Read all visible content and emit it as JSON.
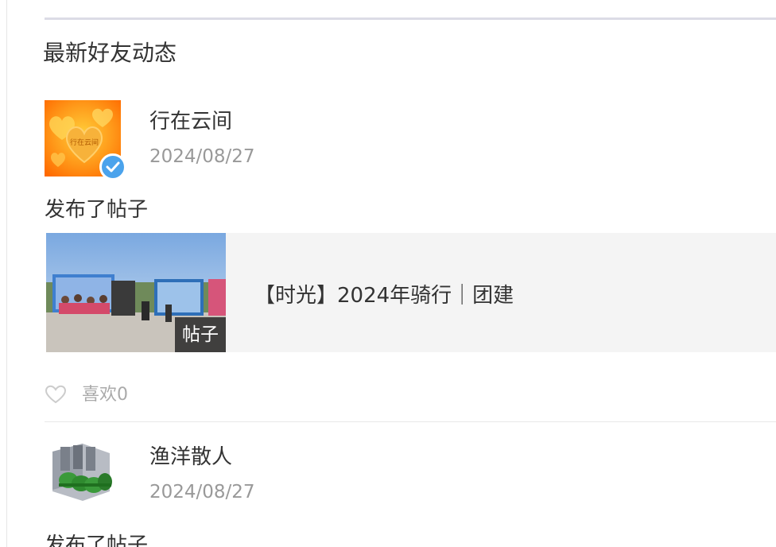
{
  "section": {
    "title": "最新好友动态"
  },
  "feed": [
    {
      "user_name": "行在云间",
      "date": "2024/08/27",
      "action": "发布了帖子",
      "avatar_icon": "heart-avatar",
      "avatar_text": "行在云间",
      "verified": true,
      "post": {
        "title": "【时光】2024年骑行｜团建",
        "tag": "帖子",
        "thumbnail": "group-photo-thumbnail"
      },
      "like": {
        "label": "喜欢0",
        "icon": "heart-outline-icon"
      }
    },
    {
      "user_name": "渔洋散人",
      "date": "2024/08/27",
      "action": "发布了帖子",
      "avatar_icon": "engine-model-avatar",
      "verified": false
    }
  ],
  "colors": {
    "verified_badge": "#4ba3ec",
    "card_background": "#f4f4f4",
    "muted_text": "#999999"
  }
}
